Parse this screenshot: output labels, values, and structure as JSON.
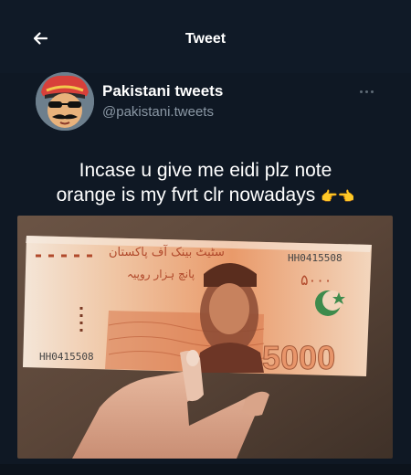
{
  "header": {
    "title": "Tweet",
    "back_icon": "arrow-left-icon"
  },
  "author": {
    "name": "Pakistani tweets",
    "handle": "@pakistani.tweets",
    "more_icon": "more-options-icon"
  },
  "tweet": {
    "line1": "Incase u give me eidi plz note",
    "line2_text": "orange is my fvrt clr nowadays",
    "emoji": "👉👈"
  },
  "media": {
    "serial_top": "HH0415508",
    "serial_bottom": "HH0415508",
    "denomination": "5000",
    "urdu_top": "سٹیٹ بینک آف پاکستان",
    "urdu_amount": "پانچ ہزار روپیہ",
    "urdu_numeral": "۵۰۰۰"
  },
  "colors": {
    "background": "#0f1824",
    "text_primary": "#ffffff",
    "text_secondary": "#8b98a5",
    "note_orange": "#e79a66"
  }
}
